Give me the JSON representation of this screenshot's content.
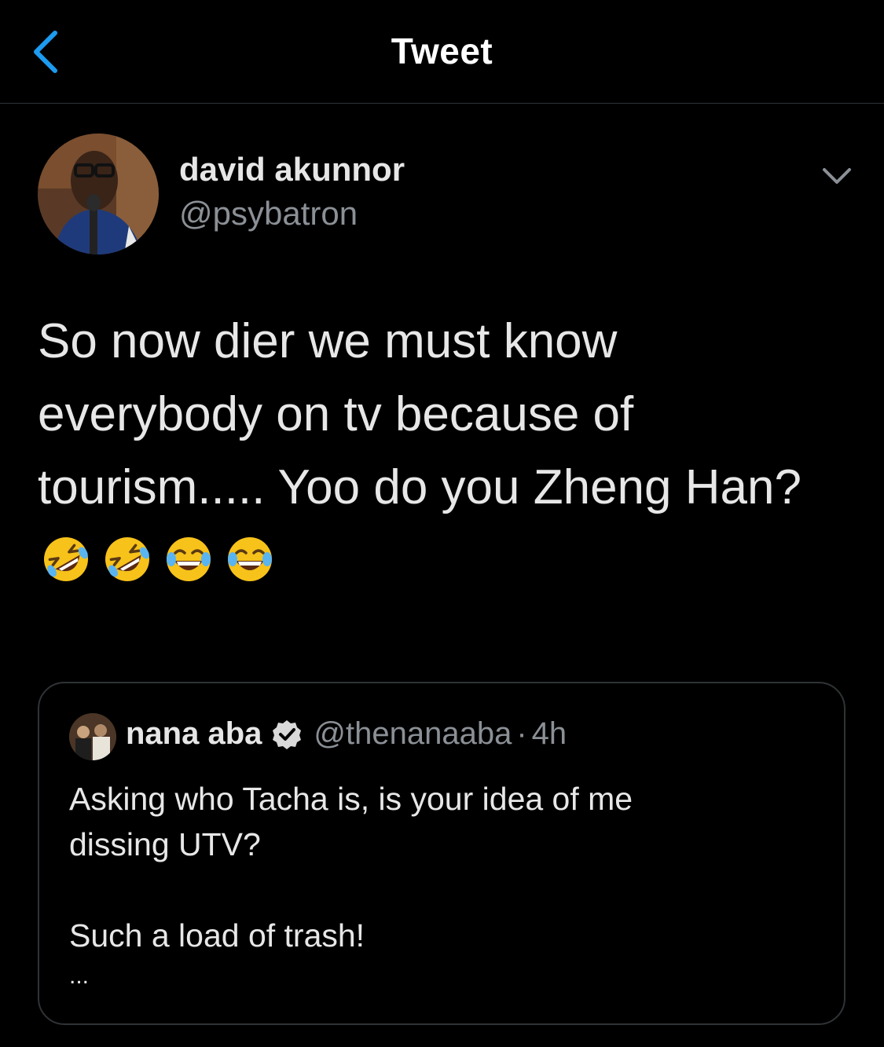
{
  "nav": {
    "title": "Tweet"
  },
  "author": {
    "name": "david akunnor",
    "handle": "@psybatron"
  },
  "tweet": {
    "text": "So now dier we must know\neverybody on tv because of\ntourism..... Yoo do you Zheng Han?",
    "emojis": [
      "rolling-on-floor-laughing",
      "rolling-on-floor-laughing",
      "tears-of-joy",
      "tears-of-joy"
    ]
  },
  "quote": {
    "name": "nana aba",
    "handle": "@thenanaaba",
    "separator": "·",
    "time": "4h",
    "verified": true,
    "line1": "Asking who Tacha is, is your idea of me",
    "line2": "dissing UTV?",
    "line3": "Such a load of trash!",
    "ellipsis": "..."
  },
  "colors": {
    "background": "#000000",
    "accent": "#1d9bf0",
    "secondary_text": "#8b9096",
    "divider": "#2f3336"
  }
}
